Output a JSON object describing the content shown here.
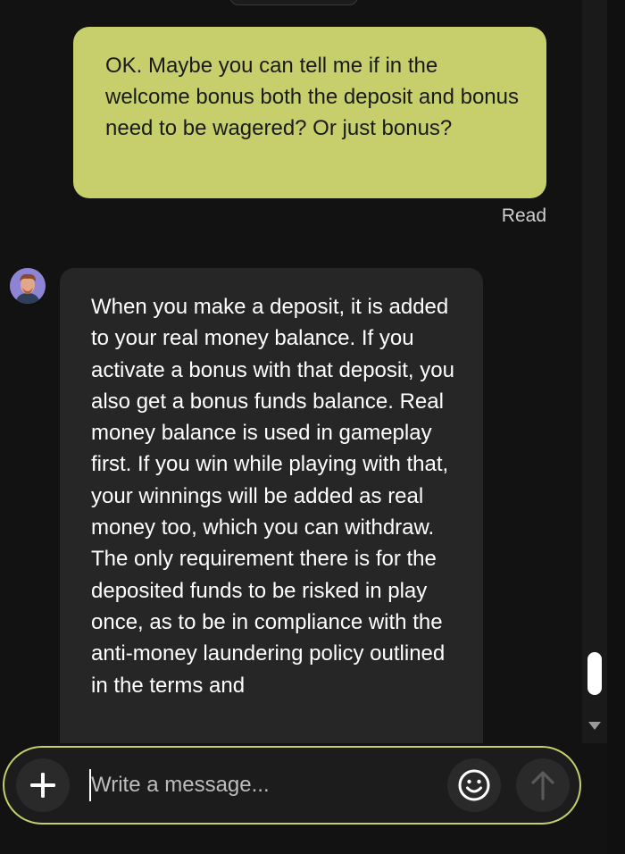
{
  "conversation": {
    "user_message": "OK. Maybe you can tell me if in the welcome bonus both the deposit and bonus need to be wagered? Or just bonus?",
    "read_receipt": "Read",
    "agent_message": "When you make a deposit, it is added to your real money balance. If you activate a bonus with that deposit, you also get a bonus funds balance. Real money balance is used in gameplay first. If you win while playing with that, your winnings will be added as real money too, which you can withdraw. The only requirement there is for the deposited funds to be risked in play once, as to be in compliance with the anti-money laundering policy outlined in the terms and"
  },
  "composer": {
    "placeholder": "Write a message..."
  },
  "icons": {
    "attach": "plus-icon",
    "emoji": "smiley-icon",
    "send": "arrow-up-icon",
    "scroll_down": "chevron-down-icon",
    "avatar": "agent-avatar"
  },
  "colors": {
    "user_bubble": "#c6cf6c",
    "agent_bubble": "#262626",
    "background": "#121212",
    "composer_border": "#c6cf6c"
  }
}
